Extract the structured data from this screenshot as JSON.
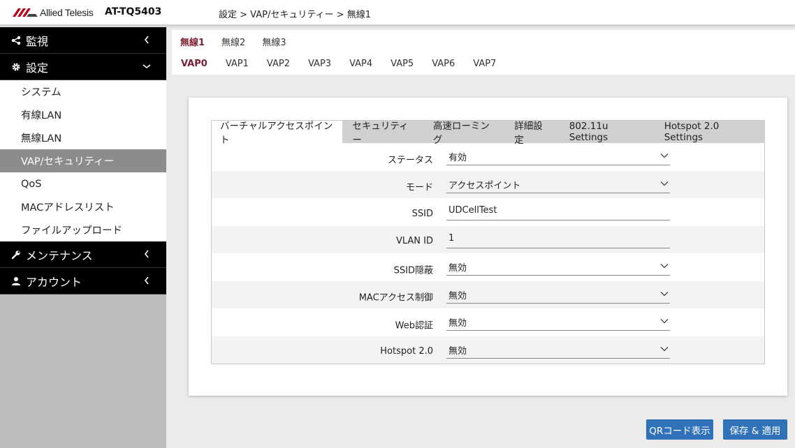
{
  "header": {
    "brand": "Allied Telesis",
    "model": "AT-TQ5403",
    "breadcrumb": "設定 > VAP/セキュリティー > 無線1"
  },
  "sidebar": {
    "groups": [
      {
        "label": "監視",
        "icon": "share-icon"
      },
      {
        "label": "設定",
        "icon": "gear-icon"
      },
      {
        "label": "メンテナンス",
        "icon": "wrench-icon"
      },
      {
        "label": "アカウント",
        "icon": "user-icon"
      }
    ],
    "settings_items": [
      {
        "label": "システム"
      },
      {
        "label": "有線LAN"
      },
      {
        "label": "無線LAN"
      },
      {
        "label": "VAP/セキュリティー",
        "active": true
      },
      {
        "label": "QoS"
      },
      {
        "label": "MACアドレスリスト"
      },
      {
        "label": "ファイルアップロード"
      }
    ]
  },
  "radio_tabs": [
    "無線1",
    "無線2",
    "無線3"
  ],
  "vap_tabs": [
    "VAP0",
    "VAP1",
    "VAP2",
    "VAP3",
    "VAP4",
    "VAP5",
    "VAP6",
    "VAP7"
  ],
  "sub_tabs": [
    "バーチャルアクセスポイント",
    "セキュリティー",
    "高速ローミング",
    "詳細設定",
    "802.11u Settings",
    "Hotspot 2.0 Settings"
  ],
  "form": {
    "status": {
      "label": "ステータス",
      "value": "有効"
    },
    "mode": {
      "label": "モード",
      "value": "アクセスポイント"
    },
    "ssid": {
      "label": "SSID",
      "value": "UDCellTest"
    },
    "vlan_id": {
      "label": "VLAN ID",
      "value": "1"
    },
    "ssid_hidden": {
      "label": "SSID隠蔽",
      "value": "無効"
    },
    "mac_access": {
      "label": "MACアクセス制御",
      "value": "無効"
    },
    "web_auth": {
      "label": "Web認証",
      "value": "無効"
    },
    "hotspot": {
      "label": "Hotspot 2.0",
      "value": "無効"
    }
  },
  "buttons": {
    "qr": "QRコード表示",
    "save": "保存 & 適用"
  },
  "colors": {
    "accent": "#7a1f2f",
    "button": "#2f72b7",
    "sidebar_bg": "#bdbdbd",
    "active_item": "#8c8c8c"
  }
}
